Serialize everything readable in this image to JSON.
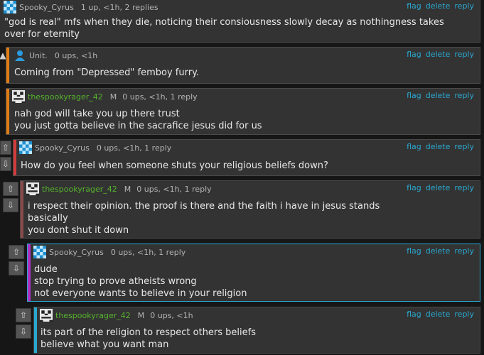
{
  "actions": {
    "flag": "flag",
    "delete": "delete",
    "reply": "reply"
  },
  "comments": [
    {
      "user": "Spooky_Cyrus",
      "meta": "1 up, <1h, 2 replies",
      "mod": "",
      "lines": [
        "\"god is real\" mfs when they die, noticing their consiousness slowly decay as nothingness takes over for eternity"
      ],
      "bar_color": "",
      "avatar_icon": "checkerboard-avatar-icon"
    },
    {
      "user": "Unit.",
      "meta": "0 ups, <1h",
      "mod": "",
      "lines": [
        "Coming from \"Depressed\" femboy furry."
      ],
      "bar_color": "#e07b14",
      "avatar_icon": "user-silhouette-icon"
    },
    {
      "user": "thespookyrager_42",
      "meta": "0 ups, <1h, 1 reply",
      "mod": "M",
      "lines": [
        "nah god will take you up there trust",
        "you just gotta believe in the sacrafice jesus did for us"
      ],
      "bar_color": "#e07b14",
      "avatar_icon": "pixel-face-avatar-icon"
    },
    {
      "user": "Spooky_Cyrus",
      "meta": "0 ups, <1h, 1 reply",
      "mod": "",
      "lines": [
        "How do you feel when someone shuts your religious beliefs down?"
      ],
      "bar_color": "#d43a3a",
      "avatar_icon": "checkerboard-avatar-icon"
    },
    {
      "user": "thespookyrager_42",
      "meta": "0 ups, <1h, 1 reply",
      "mod": "M",
      "lines": [
        "i respect their opinion. the proof is there and the faith i have in jesus stands",
        "basically",
        "you dont shut it down"
      ],
      "bar_color": "#8a4a4a",
      "avatar_icon": "pixel-face-avatar-icon"
    },
    {
      "user": "Spooky_Cyrus",
      "meta": "0 ups, <1h, 1 reply",
      "mod": "",
      "lines": [
        "dude",
        "stop trying to prove atheists wrong",
        "not everyone wants to believe in your religion"
      ],
      "bar_color": "#b02fc2",
      "avatar_icon": "checkerboard-avatar-icon"
    },
    {
      "user": "thespookyrager_42",
      "meta": "0 ups, <1h",
      "mod": "M",
      "lines": [
        "its part of the religion to respect others beliefs",
        "believe what you want man"
      ],
      "bar_color": "#2aa8cf",
      "avatar_icon": "pixel-face-avatar-icon"
    }
  ],
  "colors": {
    "link": "#2aa8cf",
    "mod_green": "#55b22d"
  }
}
